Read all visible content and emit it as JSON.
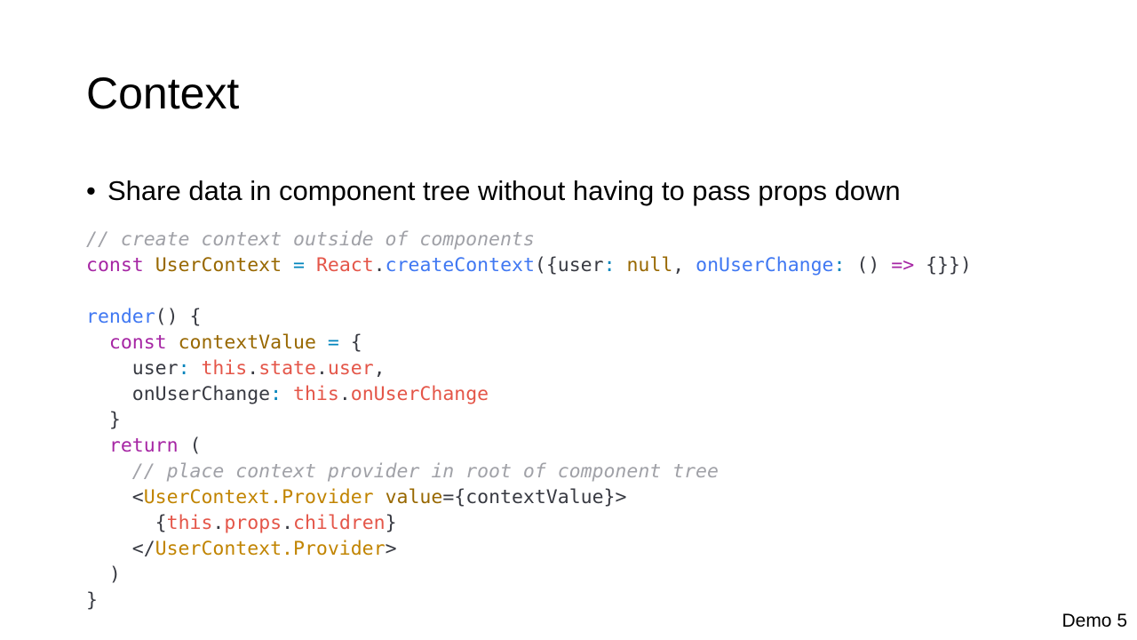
{
  "slide": {
    "title": "Context",
    "bullet_symbol": "•",
    "bullet_text": "Share data in component tree without having to pass props down",
    "footer": "Demo 5"
  },
  "code": {
    "lines": [
      [
        [
          "comment",
          "// create context outside of components"
        ]
      ],
      [
        [
          "keyword",
          "const"
        ],
        [
          "plain",
          " "
        ],
        [
          "classname",
          "UserContext"
        ],
        [
          "plain",
          " "
        ],
        [
          "operator",
          "="
        ],
        [
          "plain",
          " "
        ],
        [
          "object",
          "React"
        ],
        [
          "punct",
          "."
        ],
        [
          "func",
          "createContext"
        ],
        [
          "punct",
          "({"
        ],
        [
          "prop",
          "user"
        ],
        [
          "operator",
          ":"
        ],
        [
          "plain",
          " "
        ],
        [
          "null",
          "null"
        ],
        [
          "punct",
          ", "
        ],
        [
          "func",
          "onUserChange"
        ],
        [
          "operator",
          ":"
        ],
        [
          "plain",
          " "
        ],
        [
          "punct",
          "() "
        ],
        [
          "keyword",
          "=>"
        ],
        [
          "plain",
          " "
        ],
        [
          "punct",
          "{}})"
        ]
      ],
      [],
      [
        [
          "func",
          "render"
        ],
        [
          "punct",
          "() {"
        ]
      ],
      [
        [
          "plain",
          "  "
        ],
        [
          "keyword",
          "const"
        ],
        [
          "plain",
          " "
        ],
        [
          "classname",
          "contextValue"
        ],
        [
          "plain",
          " "
        ],
        [
          "operator",
          "="
        ],
        [
          "plain",
          " "
        ],
        [
          "punct",
          "{"
        ]
      ],
      [
        [
          "plain",
          "    "
        ],
        [
          "prop",
          "user"
        ],
        [
          "operator",
          ":"
        ],
        [
          "plain",
          " "
        ],
        [
          "object",
          "this"
        ],
        [
          "punct",
          "."
        ],
        [
          "object",
          "state"
        ],
        [
          "punct",
          "."
        ],
        [
          "object",
          "user"
        ],
        [
          "punct",
          ","
        ]
      ],
      [
        [
          "plain",
          "    "
        ],
        [
          "prop",
          "onUserChange"
        ],
        [
          "operator",
          ":"
        ],
        [
          "plain",
          " "
        ],
        [
          "object",
          "this"
        ],
        [
          "punct",
          "."
        ],
        [
          "object",
          "onUserChange"
        ]
      ],
      [
        [
          "plain",
          "  "
        ],
        [
          "punct",
          "}"
        ]
      ],
      [
        [
          "plain",
          "  "
        ],
        [
          "keyword",
          "return"
        ],
        [
          "plain",
          " "
        ],
        [
          "punct",
          "("
        ]
      ],
      [
        [
          "plain",
          "    "
        ],
        [
          "comment",
          "// place context provider in root of component tree"
        ]
      ],
      [
        [
          "plain",
          "    "
        ],
        [
          "punct",
          "<"
        ],
        [
          "tag",
          "UserContext.Provider"
        ],
        [
          "plain",
          " "
        ],
        [
          "attr",
          "value"
        ],
        [
          "punct",
          "={contextValue}>"
        ]
      ],
      [
        [
          "plain",
          "      "
        ],
        [
          "punct",
          "{"
        ],
        [
          "object",
          "this"
        ],
        [
          "punct",
          "."
        ],
        [
          "object",
          "props"
        ],
        [
          "punct",
          "."
        ],
        [
          "object",
          "children"
        ],
        [
          "punct",
          "}"
        ]
      ],
      [
        [
          "plain",
          "    "
        ],
        [
          "punct",
          "</"
        ],
        [
          "tag",
          "UserContext.Provider"
        ],
        [
          "punct",
          ">"
        ]
      ],
      [
        [
          "plain",
          "  "
        ],
        [
          "punct",
          ")"
        ]
      ],
      [
        [
          "punct",
          "}"
        ]
      ]
    ]
  }
}
